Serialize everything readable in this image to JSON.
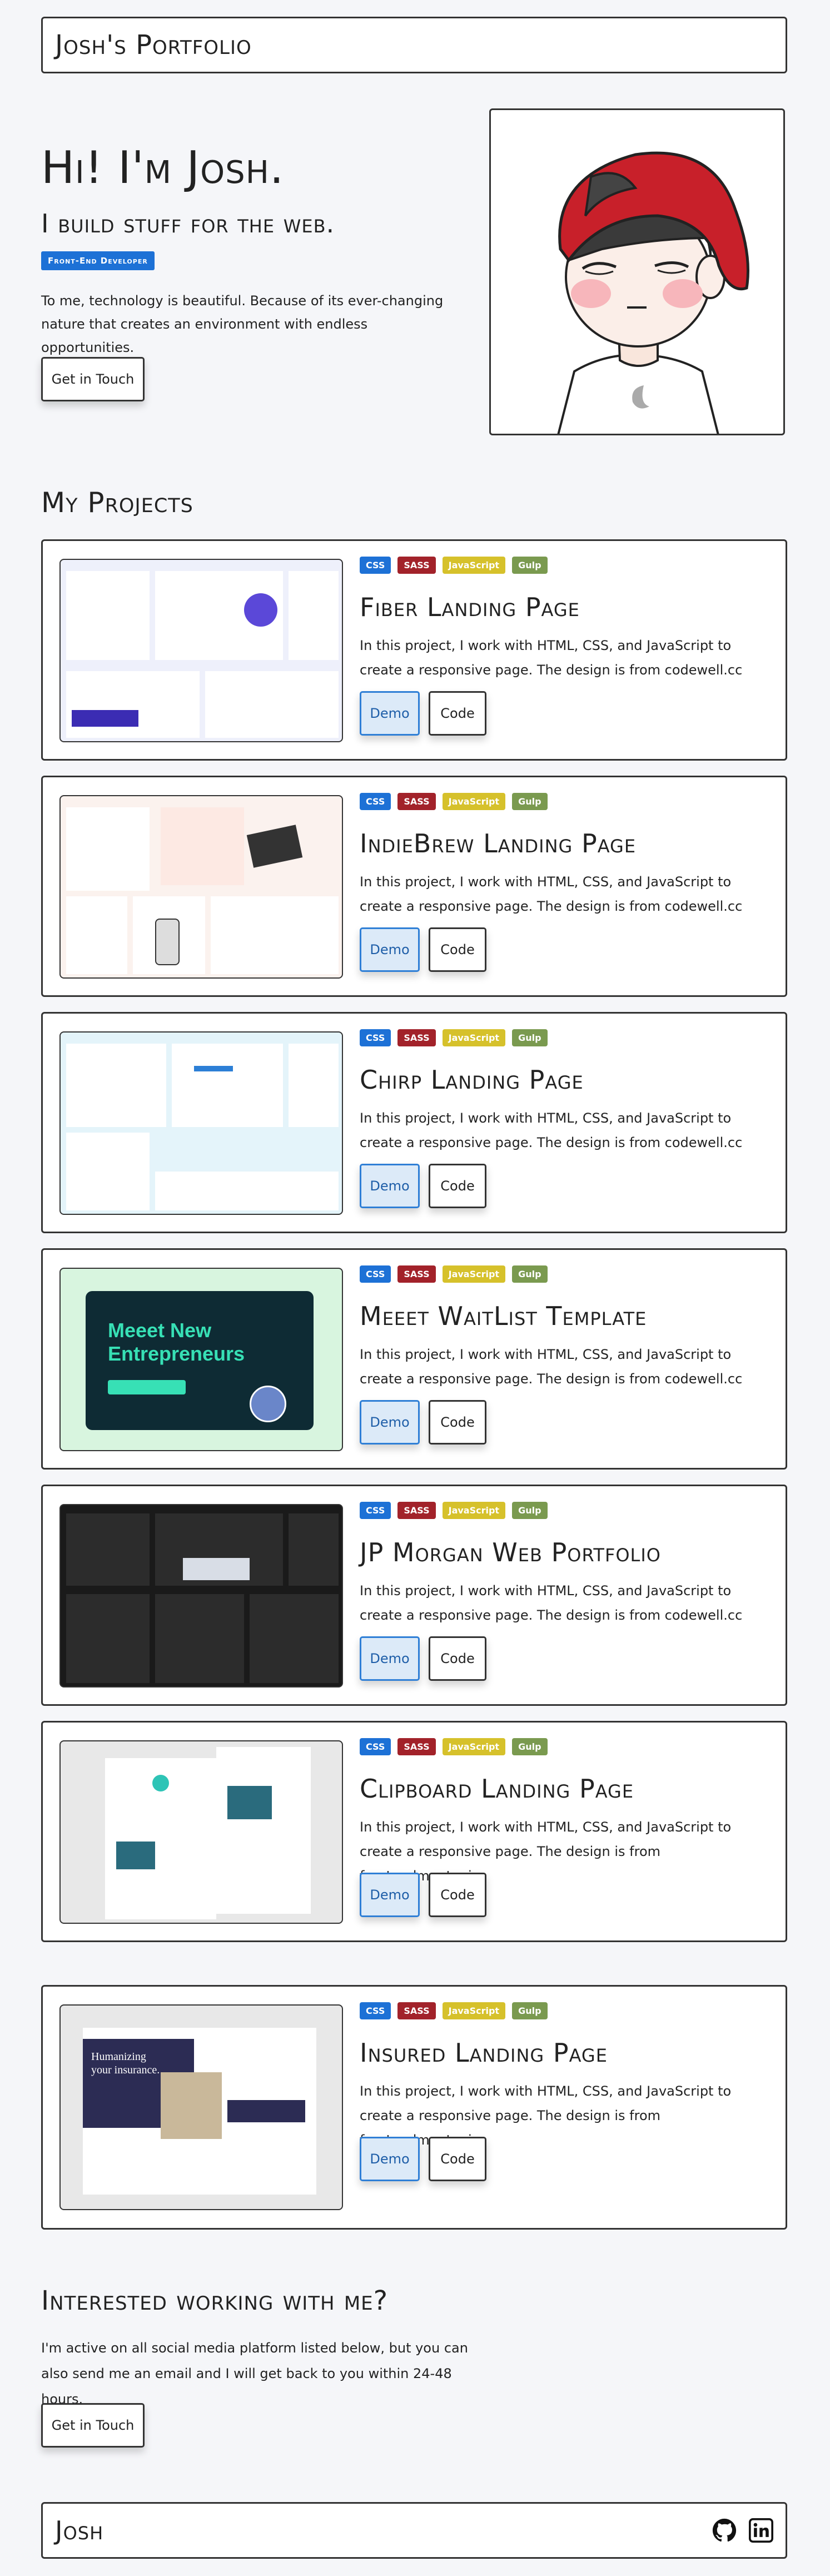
{
  "header": {
    "brand": "Josh's Portfolio"
  },
  "hero": {
    "title": "Hi! I'm Josh.",
    "subtitle": "I build stuff for the web.",
    "badge": "Front-End Developer",
    "text": "To me, technology is beautiful. Because of its ever-changing nature that creates an environment with endless opportunities.",
    "cta": "Get in Touch"
  },
  "projects": {
    "heading": "My Projects",
    "tags": [
      "CSS",
      "SASS",
      "JavaScript",
      "Gulp"
    ],
    "tag_colors": [
      "#1d71d6",
      "#a2222a",
      "#d6c12b",
      "#7a9a4f"
    ],
    "demo_label": "Demo",
    "code_label": "Code",
    "items": [
      {
        "title": "Fiber Landing Page",
        "description": "In this project, I work with HTML, CSS, and JavaScript to create a responsive page. The design is from codewell.cc"
      },
      {
        "title": "IndieBrew Landing Page",
        "description": "In this project, I work with HTML, CSS, and JavaScript to create a responsive page. The design is from codewell.cc"
      },
      {
        "title": "Chirp Landing Page",
        "description": "In this project, I work with HTML, CSS, and JavaScript to create a responsive page. The design is from codewell.cc"
      },
      {
        "title": "Meeet WaitList Template",
        "description": "In this project, I work with HTML, CSS, and JavaScript to create a responsive page. The design is from codewell.cc",
        "preview_text": "Meeet New Entrepreneurs"
      },
      {
        "title": "JP Morgan Web Portfolio",
        "description": "In this project, I work with HTML, CSS, and JavaScript to create a responsive page. The design is from codewell.cc"
      },
      {
        "title": "Clipboard Landing Page",
        "description": "In this project, I work with HTML, CSS, and JavaScript to create a responsive page. The design is from frontendmentor.io"
      },
      {
        "title": "Insured Landing Page",
        "description": "In this project, I work with HTML, CSS, and JavaScript to create a responsive page. The design is from frontendmentor.io",
        "preview_text": "Humanizing your insurance."
      }
    ]
  },
  "contact": {
    "heading": "Interested working with me?",
    "text": "I'm active on all social media platform listed below, but you can also send me an email and I will get back to you within 24-48 hours.",
    "cta": "Get in Touch"
  },
  "footer": {
    "brand": "Josh",
    "icons": [
      "github-icon",
      "linkedin-icon"
    ]
  }
}
